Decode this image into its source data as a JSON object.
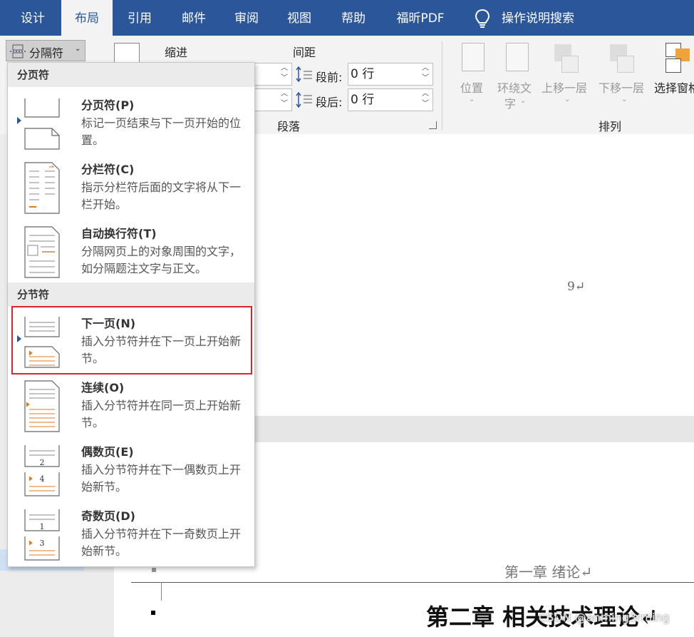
{
  "tabs": [
    {
      "label": "设计",
      "active": false
    },
    {
      "label": "布局",
      "active": true
    },
    {
      "label": "引用",
      "active": false
    },
    {
      "label": "邮件",
      "active": false
    },
    {
      "label": "审阅",
      "active": false
    },
    {
      "label": "视图",
      "active": false
    },
    {
      "label": "帮助",
      "active": false
    },
    {
      "label": "福昕PDF",
      "active": false
    }
  ],
  "tell_me": "操作说明搜索",
  "ribbon": {
    "breaks_button": "分隔符",
    "indent_label": "缩进",
    "spacing_label": "间距",
    "before_label": "段前:",
    "before_value": "0 行",
    "after_label": "段后:",
    "after_value": "0 行",
    "paragraph_group": "段落",
    "arrange_group": "排列",
    "arrange_buttons": {
      "position": "位置",
      "wrap_text_line1": "环绕文",
      "wrap_text_line2": "字",
      "bring_forward": "上移一层",
      "send_backward": "下移一层",
      "selection_pane": "选择窗格"
    }
  },
  "menu": {
    "page_breaks_header": "分页符",
    "section_breaks_header": "分节符",
    "items": [
      {
        "title": "分页符(P)",
        "desc": "标记一页结束与下一页开始的位置。"
      },
      {
        "title": "分栏符(C)",
        "desc": "指示分栏符后面的文字将从下一栏开始。"
      },
      {
        "title": "自动换行符(T)",
        "desc": "分隔网页上的对象周围的文字，如分隔题注文字与正文。"
      },
      {
        "title": "下一页(N)",
        "desc": "插入分节符并在下一页上开始新节。"
      },
      {
        "title": "连续(O)",
        "desc": "插入分节符并在同一页上开始新节。"
      },
      {
        "title": "偶数页(E)",
        "desc": "插入分节符并在下一偶数页上开始新节。"
      },
      {
        "title": "奇数页(D)",
        "desc": "插入分节符并在下一奇数页上开始新节。"
      }
    ]
  },
  "document": {
    "page_number": "9↵",
    "header_text": "第一章 绪论↵",
    "heading": "第二章 相关技术理论↵",
    "watermark": "CSDN @anming3rming"
  }
}
